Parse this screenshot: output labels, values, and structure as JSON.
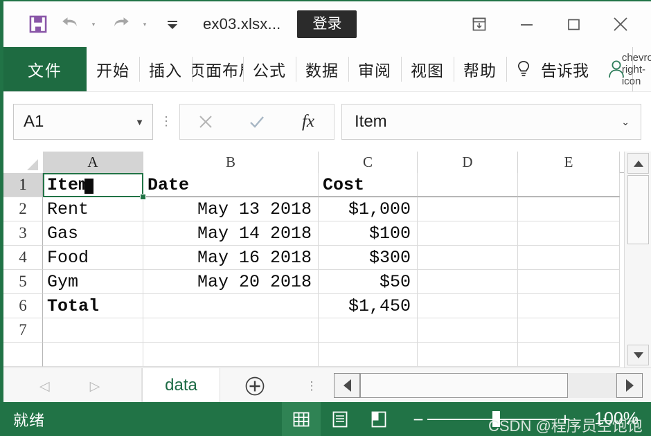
{
  "titlebar": {
    "save_icon": "save-icon",
    "undo_icon": "undo-icon",
    "redo_icon": "redo-icon",
    "customize_icon": "customize-quick-access-icon",
    "document_title": "ex03.xlsx...",
    "signin_label": "登录",
    "ribbon_display_icon": "ribbon-display-options-icon",
    "minimize_icon": "minimize-icon",
    "maximize_icon": "maximize-icon",
    "close_icon": "close-icon"
  },
  "ribbon": {
    "file_tab": "文件",
    "tabs": [
      {
        "label": "开始"
      },
      {
        "label": "插入"
      },
      {
        "label": "页面布局"
      },
      {
        "label": "公式"
      },
      {
        "label": "数据"
      },
      {
        "label": "审阅"
      },
      {
        "label": "视图"
      },
      {
        "label": "帮助"
      }
    ],
    "tellme_label": "告诉我",
    "lightbulb_icon": "lightbulb-icon",
    "account_icon": "person-icon",
    "expand_icon": "chevron-right-icon"
  },
  "formula_bar": {
    "name_box_value": "A1",
    "name_box_caret": "▼",
    "cancel_icon": "close-icon",
    "confirm_icon": "check-icon",
    "function_icon": "fx",
    "formula_value": "Item",
    "formula_caret": "⌄"
  },
  "grid": {
    "columns": [
      "A",
      "B",
      "C",
      "D",
      "E"
    ],
    "rows": [
      "1",
      "2",
      "3",
      "4",
      "5",
      "6",
      "7"
    ],
    "selected_cell": "A1",
    "cells": [
      {
        "row": 1,
        "col": "A",
        "value": "Item",
        "align": "left",
        "bold": true,
        "header": true
      },
      {
        "row": 1,
        "col": "B",
        "value": "Date",
        "align": "left",
        "bold": true,
        "header": true
      },
      {
        "row": 1,
        "col": "C",
        "value": "Cost",
        "align": "left",
        "bold": true,
        "header": true
      },
      {
        "row": 1,
        "col": "D",
        "value": "",
        "align": "left",
        "bold": false,
        "header": true
      },
      {
        "row": 1,
        "col": "E",
        "value": "",
        "align": "left",
        "bold": false,
        "header": true
      },
      {
        "row": 2,
        "col": "A",
        "value": "Rent",
        "align": "left",
        "bold": false,
        "header": false
      },
      {
        "row": 2,
        "col": "B",
        "value": "May 13 2018",
        "align": "right",
        "bold": false,
        "header": false
      },
      {
        "row": 2,
        "col": "C",
        "value": "$1,000",
        "align": "right",
        "bold": false,
        "header": false
      },
      {
        "row": 2,
        "col": "D",
        "value": "",
        "align": "left",
        "bold": false,
        "header": false
      },
      {
        "row": 2,
        "col": "E",
        "value": "",
        "align": "left",
        "bold": false,
        "header": false
      },
      {
        "row": 3,
        "col": "A",
        "value": "Gas",
        "align": "left",
        "bold": false,
        "header": false
      },
      {
        "row": 3,
        "col": "B",
        "value": "May 14 2018",
        "align": "right",
        "bold": false,
        "header": false
      },
      {
        "row": 3,
        "col": "C",
        "value": "$100",
        "align": "right",
        "bold": false,
        "header": false
      },
      {
        "row": 3,
        "col": "D",
        "value": "",
        "align": "left",
        "bold": false,
        "header": false
      },
      {
        "row": 3,
        "col": "E",
        "value": "",
        "align": "left",
        "bold": false,
        "header": false
      },
      {
        "row": 4,
        "col": "A",
        "value": "Food",
        "align": "left",
        "bold": false,
        "header": false
      },
      {
        "row": 4,
        "col": "B",
        "value": "May 16 2018",
        "align": "right",
        "bold": false,
        "header": false
      },
      {
        "row": 4,
        "col": "C",
        "value": "$300",
        "align": "right",
        "bold": false,
        "header": false
      },
      {
        "row": 4,
        "col": "D",
        "value": "",
        "align": "left",
        "bold": false,
        "header": false
      },
      {
        "row": 4,
        "col": "E",
        "value": "",
        "align": "left",
        "bold": false,
        "header": false
      },
      {
        "row": 5,
        "col": "A",
        "value": "Gym",
        "align": "left",
        "bold": false,
        "header": false
      },
      {
        "row": 5,
        "col": "B",
        "value": "May 20 2018",
        "align": "right",
        "bold": false,
        "header": false
      },
      {
        "row": 5,
        "col": "C",
        "value": "$50",
        "align": "right",
        "bold": false,
        "header": false
      },
      {
        "row": 5,
        "col": "D",
        "value": "",
        "align": "left",
        "bold": false,
        "header": false
      },
      {
        "row": 5,
        "col": "E",
        "value": "",
        "align": "left",
        "bold": false,
        "header": false
      },
      {
        "row": 6,
        "col": "A",
        "value": "Total",
        "align": "left",
        "bold": true,
        "header": false
      },
      {
        "row": 6,
        "col": "B",
        "value": "",
        "align": "left",
        "bold": false,
        "header": false
      },
      {
        "row": 6,
        "col": "C",
        "value": "$1,450",
        "align": "right",
        "bold": false,
        "header": false
      },
      {
        "row": 6,
        "col": "D",
        "value": "",
        "align": "left",
        "bold": false,
        "header": false
      },
      {
        "row": 6,
        "col": "E",
        "value": "",
        "align": "left",
        "bold": false,
        "header": false
      },
      {
        "row": 7,
        "col": "A",
        "value": "",
        "align": "left",
        "bold": false,
        "header": false
      },
      {
        "row": 7,
        "col": "B",
        "value": "",
        "align": "left",
        "bold": false,
        "header": false
      },
      {
        "row": 7,
        "col": "C",
        "value": "",
        "align": "left",
        "bold": false,
        "header": false
      },
      {
        "row": 7,
        "col": "D",
        "value": "",
        "align": "left",
        "bold": false,
        "header": false
      },
      {
        "row": 7,
        "col": "E",
        "value": "",
        "align": "left",
        "bold": false,
        "header": false
      }
    ]
  },
  "sheet_bar": {
    "prev_icon": "chevron-left-icon",
    "next_icon": "chevron-right-icon",
    "tabs": [
      {
        "label": "data",
        "active": true
      }
    ],
    "add_sheet_icon": "plus-circle-icon",
    "scroll_left_icon": "triangle-left-icon",
    "scroll_right_icon": "triangle-right-icon"
  },
  "status_bar": {
    "status_text": "就绪",
    "normal_view_icon": "grid-view-icon",
    "page_layout_icon": "page-layout-icon",
    "page_break_icon": "page-break-view-icon",
    "zoom_out_label": "−",
    "zoom_in_label": "+",
    "zoom_level": "100%"
  },
  "watermark": {
    "text": "CSDN @程序员空饱饱"
  },
  "colors": {
    "excel_green": "#217346",
    "file_tab_green": "#1e6b41",
    "signin_dark": "#2b2b2b",
    "save_purple": "#8a57a8"
  }
}
